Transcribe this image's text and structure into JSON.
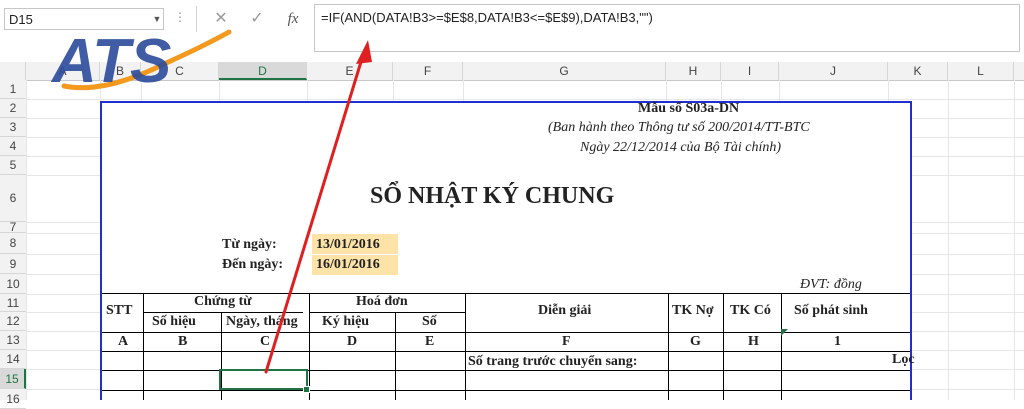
{
  "formula_bar": {
    "name_box": "D15",
    "formula": "=IF(AND(DATA!B3>=$E$8,DATA!B3<=$E$9),DATA!B3,\"\")",
    "cancel_icon": "✕",
    "enter_icon": "✓",
    "fx_label": "fx",
    "dots": "⋮"
  },
  "columns": [
    "A",
    "B",
    "C",
    "D",
    "E",
    "F",
    "G",
    "H",
    "I",
    "J",
    "K",
    "L"
  ],
  "rows": [
    "1",
    "2",
    "3",
    "4",
    "5",
    "6",
    "7",
    "8",
    "9",
    "10",
    "11",
    "12",
    "13",
    "14",
    "15",
    "16"
  ],
  "logo": {
    "text": "ATS"
  },
  "sheet": {
    "form_no": "Mẫu số S03a-DN",
    "issued_by_1": "(Ban hành theo Thông tư số 200/2014/TT-BTC",
    "issued_by_2": "Ngày 22/12/2014 của Bộ Tài chính)",
    "title": "SỔ NHẬT KÝ CHUNG",
    "from_label": "Từ ngày:",
    "from_value": "13/01/2016",
    "to_label": "Đến ngày:",
    "to_value": "16/01/2016",
    "unit": "ĐVT: đồng",
    "headers": {
      "stt": "STT",
      "chung_tu": "Chứng từ",
      "hoa_don": "Hoá đơn",
      "dien_giai": "Diễn giải",
      "tk_no": "TK Nợ",
      "tk_co": "TK Có",
      "so_phat_sinh": "Số phát sinh",
      "so_hieu": "Số hiệu",
      "ngay_thang": "Ngày, tháng",
      "ky_hieu": "Ký hiệu",
      "so": "Số"
    },
    "codes": [
      "A",
      "B",
      "C",
      "D",
      "E",
      "F",
      "G",
      "H",
      "1"
    ],
    "carry_forward": "Số trang trước chuyển sang:",
    "loc": "Lọc"
  },
  "colors": {
    "frame": "#1f2fd0",
    "highlight": "#fde3a8",
    "arrow": "#e02020",
    "selection": "#217346"
  }
}
